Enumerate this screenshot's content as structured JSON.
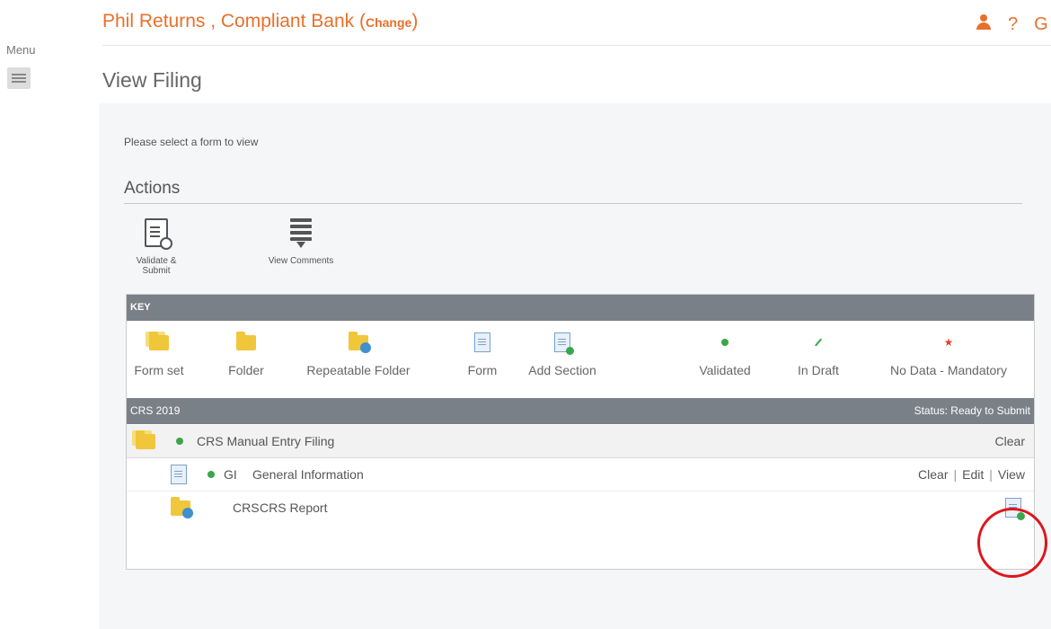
{
  "menu": {
    "label": "Menu"
  },
  "header": {
    "title": "Phil Returns , Compliant Bank",
    "change_open": "(",
    "change_label": "Change",
    "change_close": ")",
    "help_glyph": "?",
    "logout_glyph": "G"
  },
  "page": {
    "title": "View Filing",
    "instruction": "Please select a form to view"
  },
  "actions": {
    "title": "Actions",
    "validate_label": "Validate & Submit",
    "comments_label": "View Comments"
  },
  "key": {
    "header": "KEY",
    "items": [
      {
        "label": "Form set",
        "icon": "form-set-icon"
      },
      {
        "label": "Folder",
        "icon": "folder-icon"
      },
      {
        "label": "Repeatable Folder",
        "icon": "repeatable-folder-icon"
      },
      {
        "label": "Form",
        "icon": "form-icon"
      },
      {
        "label": "Add Section",
        "icon": "add-section-icon"
      },
      {
        "label": "Validated",
        "icon": "validated-icon"
      },
      {
        "label": "In Draft",
        "icon": "in-draft-icon"
      },
      {
        "label": "No Data - Mandatory",
        "icon": "no-data-mandatory-icon"
      }
    ]
  },
  "section": {
    "name": "CRS 2019",
    "status": "Status: Ready to Submit"
  },
  "rows": [
    {
      "name": "CRS Manual Entry Filing",
      "action1": "Clear"
    },
    {
      "code": "GI",
      "name": "General Information",
      "action1": "Clear",
      "action2": "Edit",
      "action3": "View"
    },
    {
      "code": "CRS",
      "name": "CRS Report"
    }
  ],
  "colors": {
    "accent": "#e8702a",
    "bar": "#7a8087",
    "validated": "#3aa64a",
    "highlight": "#e0141b"
  }
}
